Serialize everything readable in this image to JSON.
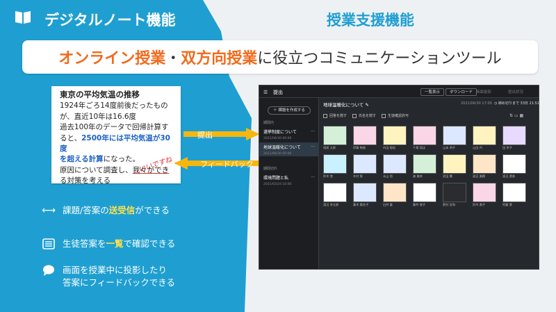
{
  "header": {
    "left_title": "デジタルノート機能",
    "right_title": "授業支援機能",
    "book_icon": "open-book-icon"
  },
  "banner": {
    "part1": "オンライン授業",
    "sep": "・",
    "part2": "双方向授業",
    "rest": "に役立つコミュニケーションツール"
  },
  "note": {
    "title": "東京の平均気温の推移",
    "line1": "1924年ごろ14度前後だったもの",
    "line2": "が、直近10年は16.6度",
    "line3": "過去100年のデータで回帰計算す",
    "line4a": "ると、",
    "line4b": "2500年には平均気温が30度",
    "line5a": "を超える計算",
    "line5b": "になった。",
    "line6a": "原因について調査し、",
    "line6b": "我々ができ",
    "line7": "る対策を考える",
    "handwriting": "いいですね"
  },
  "arrows": {
    "submit": "提出",
    "feedback": "フィードバック"
  },
  "bullets": [
    {
      "icon": "double-arrow-icon",
      "pre": "課題/答案の",
      "bold": "送受信",
      "post": "ができる"
    },
    {
      "icon": "list-icon",
      "pre": "生徒答案を",
      "bold": "一覧",
      "post": "で確認できる"
    },
    {
      "icon": "speech-bubble-icon",
      "line1": "画面を授業中に投影したり",
      "line2": "答案にフィードバックできる"
    }
  ],
  "app": {
    "window_title": "提出",
    "toolbar": [
      "一覧表示",
      "ダウンロード"
    ],
    "toolbar_dim": [
      "画面投影",
      "提出状況"
    ],
    "create_button": "＋ 課題を作成する",
    "section_open": "期間内",
    "section_closed": "期間切れ",
    "sidebar_items": [
      {
        "name": "選挙制度について",
        "date": "2021/06/30 00:00"
      },
      {
        "name": "地球温暖化について",
        "date": "2021/06/30 00:00"
      },
      {
        "name": "環境問題と私",
        "date": "2021/02/24 10:00"
      }
    ],
    "main_title": "地球温暖化について",
    "main_date": "2021/06/30 17:00",
    "timer": "締め切りまで 33日 21:51",
    "checks": [
      "回答を隠す",
      "氏名を隠す",
      "生徒確認許可"
    ],
    "students": [
      "相尾 太郎",
      "伊藤 絢香",
      "内田 聡佑",
      "千葉 翔汰",
      "山本 明子",
      "山田 円",
      "田 京子",
      "鈴木 悠",
      "木村 智",
      "永山 悟",
      "森 美奈",
      "武田 響",
      "渡辺 美穂",
      "渡辺 遼香",
      "渡辺 幸太郎",
      "藤木 舞花子",
      "臼井 蒼",
      "藤井 咲子",
      "野村 佐和",
      "鈴木 貴子",
      "阿藤 葵"
    ]
  },
  "colors": {
    "accent_blue": "#1f9fd1",
    "highlight_orange": "#f26a1b",
    "arrow_yellow": "#f6b60f",
    "bold_yellow": "#ffe14a"
  }
}
